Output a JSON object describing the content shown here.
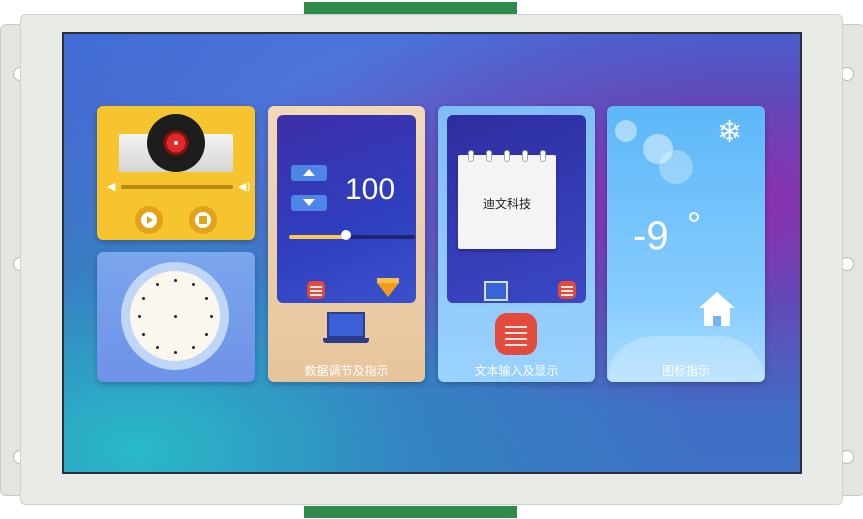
{
  "tiles": {
    "music": {
      "volume_low_icon": "speaker-low-icon",
      "volume_high_icon": "speaker-high-icon",
      "play_icon": "play-icon",
      "stop_icon": "stop-icon"
    },
    "clock": {
      "icon": "clock-icon"
    },
    "data_adjust": {
      "value": "100",
      "slider_level": 0.45,
      "label": "数据调节及指示"
    },
    "text_input": {
      "notepad_text": "迪文科技",
      "label": "文本输入及显示"
    },
    "icon_indicator": {
      "temperature": "-9",
      "weather_icon": "snowflake-icon",
      "label": "图标指示"
    }
  },
  "colors": {
    "music_bg": "#f6c42e",
    "clock_bg": "#6e92e8",
    "adjust_bg": "#e8c59b",
    "text_bg": "#9ad2ff",
    "weather_bg": "#5db8f8",
    "accent_red": "#e24b3b",
    "green_connector": "#2f8a4d"
  }
}
